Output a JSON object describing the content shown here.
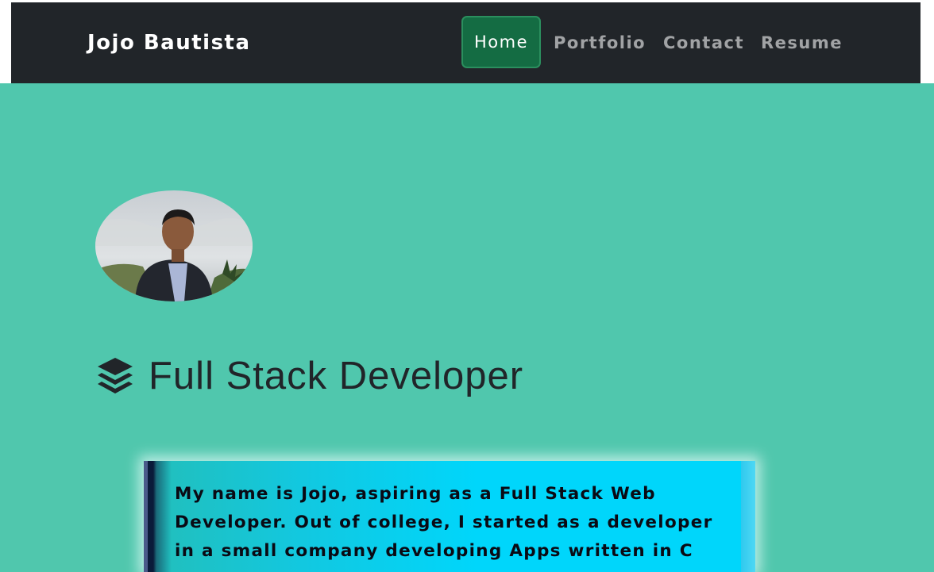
{
  "navbar": {
    "brand": "Jojo Bautista",
    "links": [
      {
        "label": "Home",
        "active": true
      },
      {
        "label": "Portfolio",
        "active": false
      },
      {
        "label": "Contact",
        "active": false
      },
      {
        "label": "Resume",
        "active": false
      }
    ]
  },
  "hero": {
    "avatar_icon": "profile-photo",
    "heading_icon": "layer-group-icon",
    "heading": "Full Stack Developer"
  },
  "bio": {
    "text": "My name is Jojo, aspiring as a Full Stack Web Developer. Out of college, I started as a developer in a small company developing Apps written in C"
  },
  "colors": {
    "page_background": "#50c7ad",
    "navbar_background": "#212529",
    "active_link_background": "#146c43",
    "card_accent": "#00d6fb"
  }
}
